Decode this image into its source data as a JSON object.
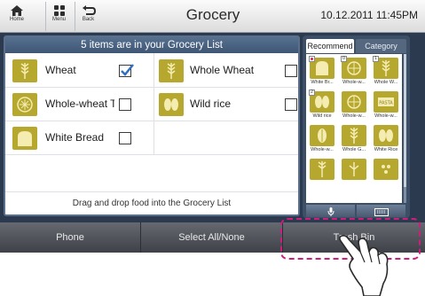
{
  "topbar": {
    "home_label": "Home",
    "menu_label": "Menu",
    "back_label": "Back",
    "title": "Grocery",
    "datetime": "10.12.2011 11:45PM"
  },
  "list": {
    "header": "5 items are in your Grocery List",
    "items": [
      {
        "label": "Wheat",
        "checked": true,
        "icon": "wheat-icon"
      },
      {
        "label": "Whole Wheat",
        "checked": false,
        "icon": "wheat-icon"
      },
      {
        "label": "Whole-wheat Tort",
        "checked": false,
        "icon": "tortilla-icon"
      },
      {
        "label": "Wild rice",
        "checked": false,
        "icon": "rice-icon"
      },
      {
        "label": "White Bread",
        "checked": false,
        "icon": "bread-icon"
      }
    ],
    "hint": "Drag and drop food into the Grocery List"
  },
  "side": {
    "tab_recommend": "Recommend",
    "tab_category": "Category",
    "thumbs": [
      {
        "label": "White Br...",
        "badge": "dot",
        "icon": "bread-icon"
      },
      {
        "label": "Whole-w...",
        "badge": "0",
        "icon": "tortilla-icon"
      },
      {
        "label": "Whole W...",
        "badge": "1",
        "icon": "wheat-icon"
      },
      {
        "label": "Wild rice",
        "badge": "2",
        "icon": "rice-icon"
      },
      {
        "label": "Whole-w...",
        "badge": "",
        "icon": "tortilla-icon"
      },
      {
        "label": "Whole-w...",
        "badge": "",
        "icon": "pasta-icon",
        "text": "PASTA"
      },
      {
        "label": "Whole-w...",
        "badge": "",
        "icon": "corn-icon"
      },
      {
        "label": "Whole G...",
        "badge": "",
        "icon": "wheat-icon"
      },
      {
        "label": "White Rice",
        "badge": "",
        "icon": "rice-icon"
      },
      {
        "label": "",
        "badge": "",
        "icon": "wheat-icon"
      },
      {
        "label": "",
        "badge": "",
        "icon": "grain-icon"
      },
      {
        "label": "",
        "badge": "",
        "icon": "seeds-icon"
      }
    ]
  },
  "bottombar": {
    "phone": "Phone",
    "select_all": "Select All/None",
    "trash": "Trash Bin"
  },
  "colors": {
    "accent_blue": "#4a607f",
    "food_tile": "#b6a72e",
    "highlight": "#d01c7e"
  }
}
